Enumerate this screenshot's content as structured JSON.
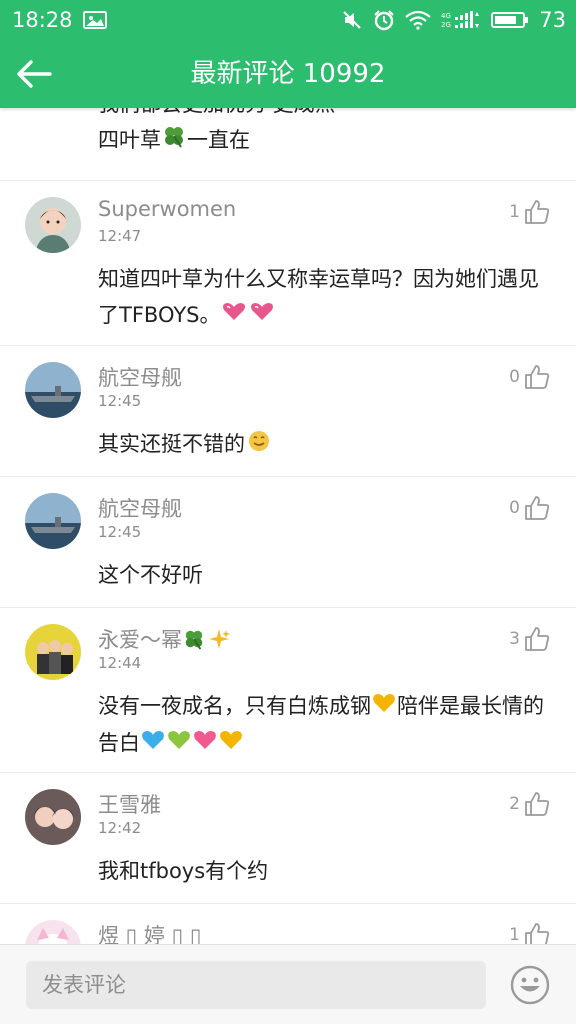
{
  "status_bar": {
    "time": "18:28",
    "battery": "73",
    "icons": [
      "image-icon",
      "mute-icon",
      "alarm-icon",
      "wifi-icon",
      "signal-icon",
      "battery-icon"
    ]
  },
  "header": {
    "back_icon": "back-arrow-icon",
    "title": "最新评论 10992"
  },
  "comments": [
    {
      "partial": true,
      "line1": "我们都会更加优秀 更成熟",
      "text": "四叶草",
      "text_after": "一直在"
    },
    {
      "name": "Superwomen",
      "time": "12:47",
      "likes": "1",
      "text": "知道四叶草为什么又称幸运草吗？因为她们遇见了TFBOYS。"
    },
    {
      "name": "航空母舰",
      "time": "12:45",
      "likes": "0",
      "text": "其实还挺不错的"
    },
    {
      "name": "航空母舰",
      "time": "12:45",
      "likes": "0",
      "text": "这个不好听"
    },
    {
      "name": "永爱～幂",
      "time": "12:44",
      "likes": "3",
      "text_a": "没有一夜成名，只有白炼成钢",
      "text_b": "陪伴是最长情的告白"
    },
    {
      "name": "王雪雅",
      "time": "12:42",
      "likes": "2",
      "text": "我和tfboys有个约"
    },
    {
      "name": "煜 ▯ 婷 ▯ ▯",
      "likes": "1"
    }
  ],
  "bottom": {
    "placeholder": "发表评论",
    "emoji_icon": "smiley-face-icon"
  },
  "colors": {
    "brand_green": "#2dbd6e",
    "muted_text": "#8c8c8c"
  }
}
